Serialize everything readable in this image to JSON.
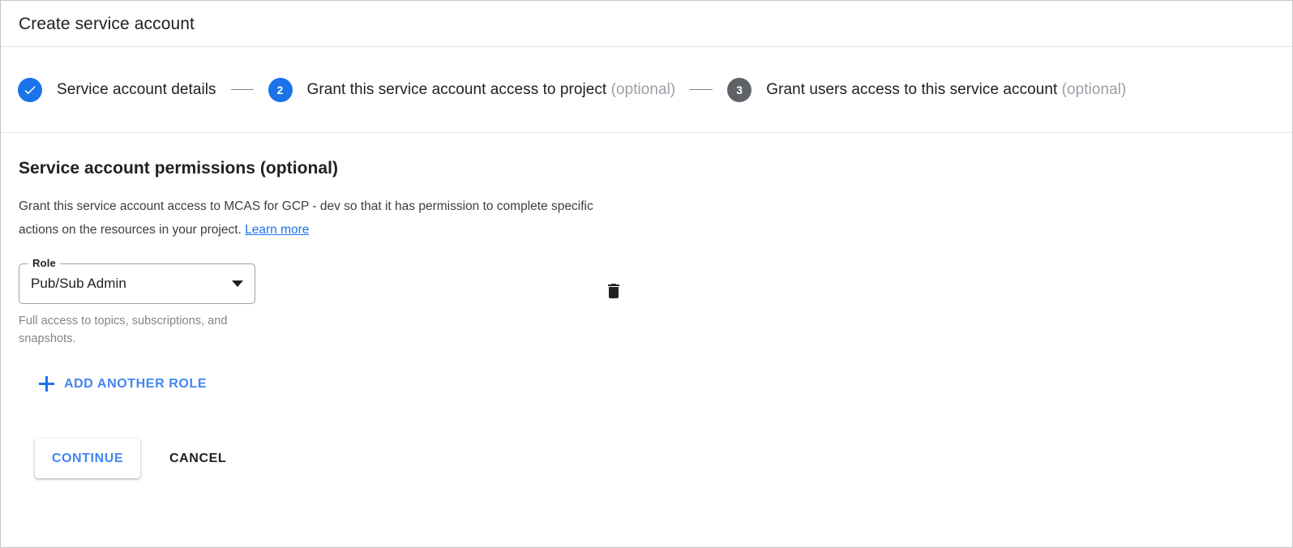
{
  "dialog": {
    "title": "Create service account"
  },
  "stepper": {
    "separator": "—",
    "steps": [
      {
        "number": "1",
        "marker": "check-icon",
        "state": "completed",
        "label": "Service account details",
        "optional": ""
      },
      {
        "number": "2",
        "marker": "2",
        "state": "active",
        "label": "Grant this service account access to project",
        "optional": "(optional)"
      },
      {
        "number": "3",
        "marker": "3",
        "state": "upcoming",
        "label": "Grant users access to this service account",
        "optional": "(optional)"
      }
    ]
  },
  "section": {
    "heading": "Service account permissions (optional)",
    "description": "Grant this service account access to MCAS for GCP - dev so that it has permission to complete specific actions on the resources in your project.",
    "learn_more": "Learn more"
  },
  "role": {
    "field_label": "Role",
    "selected_value": "Pub/Sub Admin",
    "helper_text": "Full access to topics, subscriptions, and snapshots.",
    "delete_icon": "trash-icon"
  },
  "actions": {
    "add_another_role": "ADD ANOTHER ROLE",
    "add_icon": "plus-icon",
    "continue": "CONTINUE",
    "cancel": "CANCEL"
  },
  "colors": {
    "accent_blue": "#1a73e8",
    "link_blue": "#4285f4",
    "inactive_gray": "#5f6368",
    "muted_text": "#9aa0a6",
    "divider": "#e4e6e8"
  }
}
